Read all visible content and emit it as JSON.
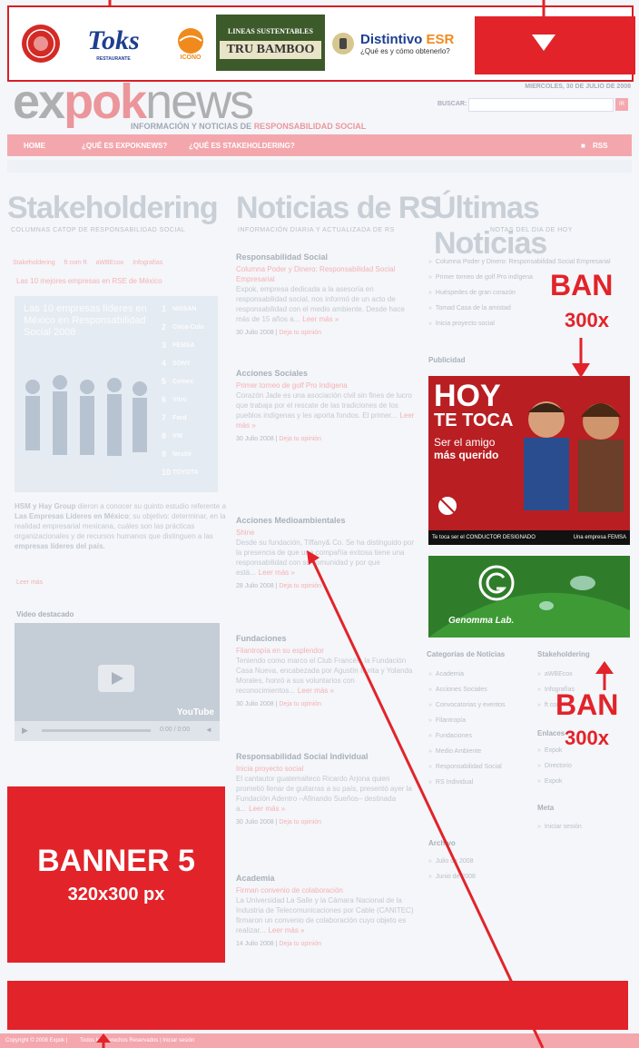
{
  "top_banner": {
    "toks": "Toks",
    "toks_sub": "RESTAURANTE",
    "icono": "ICONO",
    "lineas": "LINEAS SUSTENTABLES",
    "tru": "TRU",
    "bamboo": "BAMBOO",
    "distintivo": "Distintivo",
    "esr": "ESR",
    "distintivo_sub": "¿Qué es y cómo obtenerlo?"
  },
  "header": {
    "logo_ex": "ex",
    "logo_pok": "pok",
    "logo_news": "news",
    "tagline_a": "INFORMACIÓN Y NOTICIAS DE ",
    "tagline_b": "RESPONSABILIDAD SOCIAL",
    "date": "MIERCOLES, 30 DE JULIO DE 2008",
    "search_label": "BUSCAR:",
    "search_button": "IR"
  },
  "nav": {
    "home": "HOME",
    "que_es": "¿QUÉ ES EXPOKNEWS?",
    "stakeholdering": "¿QUÉ ES STAKEHOLDERING?",
    "rss": "RSS"
  },
  "columns": {
    "c1_title": "Stakeholdering",
    "c1_sub": "COLUMNAS CATOP DE RESPONSABILIDAD SOCIAL",
    "c2_title": "Noticias de RS",
    "c2_sub": "INFORMACIÓN DIARIA Y ACTUALIZADA DE RS",
    "c3_title": "Últimas Noticias",
    "c3_sub": "NOTAS DEL DIA DE HOY"
  },
  "left": {
    "tabs": [
      "Stakeholdering",
      "ft com ft",
      "aWBEcox",
      "Infografías"
    ],
    "feature_title": "Las 10 mejores empresas en RSE de México",
    "poster_title": "Las 10 empresas líderes en México en Responsabilidad Social 2008",
    "ranks": [
      "1",
      "2",
      "3",
      "4",
      "5",
      "6",
      "7",
      "8",
      "9",
      "10"
    ],
    "brands": [
      "NISSAN",
      "Coca-Cola",
      "FEMSA",
      "SONY",
      "Cemex",
      "Vitro",
      "Ford",
      "VW",
      "Nestlé",
      "TOYOTA"
    ],
    "body_a": "HSM y Hay Group",
    "body_b": " dieron a conocer su quinto estudio referente a ",
    "body_c": "Las Empresas Líderes en México",
    "body_d": "; su objetivo: determinar, en la realidad empresarial mexicana, cuáles son las prácticas organizacionales y de recursos humanos que distinguen a las ",
    "body_e": "empresas líderes del país.",
    "read_more": "Leer más",
    "video_title": "Video destacado",
    "video_time": "0:00 / 0:00",
    "youtube": "YouTube"
  },
  "banner5": {
    "title": "BANNER 5",
    "size": "320x300 px"
  },
  "middle": [
    {
      "cat": "Responsabilidad Social",
      "link": "Columna Poder y Dinero: Responsabilidad Social Empresarial",
      "body": "Expok, empresa dedicada a la asesoría en responsabilidad social, nos informó de un acto de responsabilidad con el medio ambiente. Desde hace más de 15 años a...",
      "more": "Leer más »",
      "meta": "30 Julio 2008 |",
      "meta_link": " Deja tu opinión"
    },
    {
      "cat": "Acciones Sociales",
      "link": "Primer torneo de golf Pro Indígena",
      "body": "Corazón Jade es una asociación civil sin fines de lucro que trabaja por el rescate de las tradiciones de los pueblos indígenas y les aporta fondos. El primer...",
      "more": "Leer más »",
      "meta": "30 Julio 2008 |",
      "meta_link": " Deja tu opinión"
    },
    {
      "cat": "Acciones Medioambientales",
      "link": "Shine",
      "body": "Desde su fundación, Tiffany& Co. Se ha distinguido por la presencia de que una compañía exitosa tiene una responsabilidad con su comunidad y por que está...",
      "more": "Leer más »",
      "meta": "28 Julio 2008 |",
      "meta_link": " Deja tu opinión"
    },
    {
      "cat": "Fundaciones",
      "link": "Filantropía en su esplendor",
      "body": "Teniendo como marco el Club Francés, la Fundación Casa Nueva, encabezada por Agustín Irurita y Yolanda Morales, honró a sus voluntarios con reconocimientos...",
      "more": "Leer más »",
      "meta": "30 Julio 2008 |",
      "meta_link": " Deja tu opinión"
    },
    {
      "cat": "Responsabilidad Social Individual",
      "link": "Inicia proyecto social",
      "body": "El cantautor guatemalteco Ricardo Arjona quien prometió llenar de guitarras a su país, presentó ayer la Fundación Adentro –Afinando Sueños– destinada a...",
      "more": "Leer más »",
      "meta": "30 Julio 2008 |",
      "meta_link": " Deja tu opinión"
    },
    {
      "cat": "Academia",
      "link": "Firman convenio de colaboración",
      "body": "La Universidad La Salle y la Cámara Nacional de la Industria de Telecomunicaciones por Cable (CANITEC) firmaron un convenio de colaboración cuyo objeto es realizar...",
      "more": "Leer más »",
      "meta": "14 Julio 2008 |",
      "meta_link": " Deja tu opinión"
    }
  ],
  "right": {
    "latest": [
      "Columna Poder y Dinero: Responsabilidad Social Empresarial",
      "Primer torneo de golf Pro indígena",
      "Huéspedes de gran corazón",
      "Tomad Casa de la amistad",
      "Inicia proyecto social"
    ],
    "publicidad": "Publicidad",
    "ad1_hoy": "HOY",
    "ad1_te_toca": "TE TOCA",
    "ad1_line1": "Ser el amigo",
    "ad1_line2": "más querido",
    "ad1_footer": "Te toca ser el CONDUCTOR DESIGNADO",
    "ad1_femsa": "Una empresa FEMSA",
    "ad2_brand": "Genomma Lab.",
    "cat_title": "Categorías de Noticias",
    "categories": [
      "Academia",
      "Acciones Sociales",
      "Convocatorias y eventos",
      "Filantropía",
      "Fundaciones",
      "Medio Ambiente",
      "Responsabilidad Social",
      "RS Individual"
    ],
    "stake_title": "Stakeholdering",
    "stake_items": [
      "aWBEcox",
      "Infografías",
      "ft com ft"
    ],
    "archivo_title": "Archivo",
    "archivo_items": [
      "Julio de 2008",
      "Junio de 2008"
    ],
    "enlaces_title": "Enlaces",
    "enlaces_items": [
      "Expok",
      "Directorio",
      "Expok"
    ],
    "meta_title": "Meta",
    "meta_items": [
      "Iniciar sesión"
    ]
  },
  "overlay": {
    "ban_right1": "BAN",
    "ban_right1_size": "300x",
    "ban_right2": "BAN",
    "ban_right2_size": "300x"
  },
  "footer": {
    "text_a": "Copyright © 2008 Expok |",
    "text_b": "Todos los Derechos Reservados | Iniciar sesión"
  }
}
